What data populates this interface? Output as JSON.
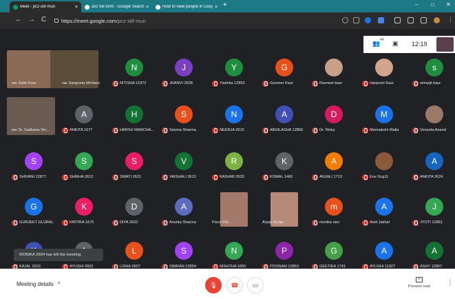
{
  "browser": {
    "tabs": [
      {
        "title": "Meet - pcz-stif-mun",
        "active": true,
        "favicon_color": "#00a85a"
      },
      {
        "title": "avc full form - Google Search",
        "active": false,
        "favicon_color": "#ffffff"
      },
      {
        "title": "How to view people in Google M",
        "active": false,
        "favicon_color": "#ffffff"
      }
    ],
    "new_tab_label": "+",
    "tab_close_label": "×",
    "window_controls": {
      "minimize": "–",
      "maximize": "□",
      "close": "✕"
    },
    "nav": {
      "back": "←",
      "forward": "→",
      "reload": "C"
    },
    "url": {
      "domain": "https://meet.google.com",
      "path": "/pcz-stif-mun"
    }
  },
  "meet_info": {
    "people_icon": "people-icon",
    "people_badge": "44",
    "chat_icon": "chat-icon",
    "time": "12:19"
  },
  "participants": [
    {
      "row": 0,
      "col": 0,
      "name": "Sabir Kaur",
      "video": true,
      "video_color": "#8a6a55",
      "dots": true,
      "mic_off": false
    },
    {
      "row": 0,
      "col": 1,
      "name": "Sangeeta Mehtani",
      "video": true,
      "video_color": "#5a4e3b",
      "dots": true,
      "mic_off": false
    },
    {
      "row": 0,
      "col": 2,
      "name": "NITISHA 11972",
      "initial": "N",
      "color": "#1e8e3e",
      "mic_off": true
    },
    {
      "row": 0,
      "col": 3,
      "name": "JHANVI 2628",
      "initial": "J",
      "color": "#7b3fc4",
      "mic_off": true
    },
    {
      "row": 0,
      "col": 4,
      "name": "Yashika 12852",
      "initial": "Y",
      "color": "#1e8e3e",
      "mic_off": true
    },
    {
      "row": 0,
      "col": 5,
      "name": "Gurnoor Kaur",
      "initial": "G",
      "color": "#e8501c",
      "mic_off": true
    },
    {
      "row": 0,
      "col": 6,
      "name": "Ravneet kaur",
      "photo": true,
      "color": "#c7a08a",
      "mic_off": true
    },
    {
      "row": 0,
      "col": 7,
      "name": "Harpreet Kaur",
      "photo": true,
      "color": "#d1a48b",
      "mic_off": true
    },
    {
      "row": 0,
      "col": 8,
      "name": "simarjit kaur",
      "initial": "s",
      "color": "#1e8e3e",
      "mic_off": true
    },
    {
      "row": 1,
      "col": 0,
      "name": "Dr. Sadhana Ver...",
      "video": true,
      "video_color": "#6a5a50",
      "dots": true,
      "mic_off": false
    },
    {
      "row": 1,
      "col": 1,
      "name": "ANKITA 1677",
      "initial": "A",
      "color": "#5f6368",
      "mic_off": true
    },
    {
      "row": 1,
      "col": 2,
      "name": "HARSH MANCHA...",
      "initial": "H",
      "color": "#137333",
      "mic_off": true
    },
    {
      "row": 1,
      "col": 3,
      "name": "Seema Sharma",
      "initial": "S",
      "color": "#e8501c",
      "mic_off": true
    },
    {
      "row": 1,
      "col": 4,
      "name": "NEERJA 2615",
      "initial": "N",
      "color": "#1a73e8",
      "mic_off": true
    },
    {
      "row": 1,
      "col": 5,
      "name": "ABHILASHA 12856",
      "initial": "A",
      "color": "#3f51b5",
      "mic_off": true
    },
    {
      "row": 1,
      "col": 6,
      "name": "Dr. Rinky",
      "initial": "D",
      "color": "#d81b60",
      "mic_off": true
    },
    {
      "row": 1,
      "col": 7,
      "name": "Meenakshi Walia",
      "initial": "M",
      "color": "#1a73e8",
      "mic_off": true
    },
    {
      "row": 1,
      "col": 8,
      "name": "Veneeta Anand",
      "photo": true,
      "color": "#9a7a66",
      "mic_off": true
    },
    {
      "row": 2,
      "col": 0,
      "name": "SHIVANI 12877",
      "initial": "S",
      "color": "#a142f4",
      "mic_off": true
    },
    {
      "row": 2,
      "col": 1,
      "name": "SHIKHA 2612",
      "initial": "S",
      "color": "#34a853",
      "mic_off": true
    },
    {
      "row": 2,
      "col": 2,
      "name": "SWATI 2621",
      "initial": "S",
      "color": "#e91e63",
      "mic_off": true
    },
    {
      "row": 2,
      "col": 3,
      "name": "VAISHALI 2613",
      "initial": "V",
      "color": "#137333",
      "mic_off": true
    },
    {
      "row": 2,
      "col": 4,
      "name": "RASHMI 2633",
      "initial": "R",
      "color": "#7cb342",
      "mic_off": true
    },
    {
      "row": 2,
      "col": 5,
      "name": "KOMAL 1460",
      "initial": "K",
      "color": "#5f6368",
      "mic_off": true
    },
    {
      "row": 2,
      "col": 6,
      "name": "ANJALI 1713",
      "initial": "A",
      "color": "#f57c00",
      "mic_off": true
    },
    {
      "row": 2,
      "col": 7,
      "name": "Env Gcg11",
      "photo": true,
      "color": "#8a5a3a",
      "mic_off": true
    },
    {
      "row": 2,
      "col": 8,
      "name": "ANKITA 2624",
      "initial": "A",
      "color": "#1565c0",
      "mic_off": true
    },
    {
      "row": 3,
      "col": 0,
      "name": "GURJEET GUJRAL",
      "initial": "G",
      "color": "#1a73e8",
      "mic_off": true
    },
    {
      "row": 3,
      "col": 1,
      "name": "KRITIKA 1675",
      "initial": "K",
      "color": "#e91e63",
      "mic_off": true
    },
    {
      "row": 3,
      "col": 2,
      "name": "DIYA 2632",
      "initial": "D",
      "color": "#5f6368",
      "mic_off": true
    },
    {
      "row": 3,
      "col": 3,
      "name": "Anurita Sharma",
      "initial": "A",
      "color": "#5c6bc0",
      "mic_off": true
    },
    {
      "row": 3,
      "col": 4,
      "name": "Parul Virk ...",
      "video": true,
      "video_color": "#a37a6a",
      "dots": false,
      "mic_off": false
    },
    {
      "row": 3,
      "col": 5,
      "name": "Arpan Kullar",
      "video": true,
      "video_color": "#b58a78",
      "dots": false,
      "mic_off": false
    },
    {
      "row": 3,
      "col": 6,
      "name": "monika rani",
      "initial": "m",
      "color": "#e8501c",
      "mic_off": true
    },
    {
      "row": 3,
      "col": 7,
      "name": "Amit Jakhal",
      "initial": "A",
      "color": "#1a73e8",
      "mic_off": true
    },
    {
      "row": 3,
      "col": 8,
      "name": "JYOTI 12861",
      "initial": "J",
      "color": "#34a853",
      "mic_off": true
    },
    {
      "row": 4,
      "col": 0,
      "name": "KAJAL 2623",
      "initial": "K",
      "color": "#3f51b5",
      "mic_off": true
    },
    {
      "row": 4,
      "col": 1,
      "name": "AYUSHI 2603",
      "initial": "A",
      "color": "#5f6368",
      "mic_off": true
    },
    {
      "row": 4,
      "col": 2,
      "name": "LISHA 2607",
      "initial": "L",
      "color": "#e8501c",
      "mic_off": true
    },
    {
      "row": 4,
      "col": 3,
      "name": "SIMRAN 12854",
      "initial": "S",
      "color": "#a142f4",
      "mic_off": true
    },
    {
      "row": 4,
      "col": 4,
      "name": "NISHTHA 1655",
      "initial": "N",
      "color": "#34a853",
      "mic_off": true
    },
    {
      "row": 4,
      "col": 5,
      "name": "POONAM 12853",
      "initial": "P",
      "color": "#8e24aa",
      "mic_off": true
    },
    {
      "row": 4,
      "col": 6,
      "name": "GEETIKA 1741",
      "initial": "G",
      "color": "#43a047",
      "mic_off": true
    },
    {
      "row": 4,
      "col": 7,
      "name": "AYUSHI 11927",
      "initial": "A",
      "color": "#1a73e8",
      "mic_off": true
    },
    {
      "row": 4,
      "col": 8,
      "name": "ASHY 12867",
      "initial": "A",
      "color": "#137333",
      "mic_off": true
    }
  ],
  "toast": "MONIKA 2604 has left the meeting",
  "bottom": {
    "details_label": "Meeting details",
    "details_chevron": "^",
    "present_label": "Present now",
    "mic_icon": "mic-off-icon",
    "hangup_icon": "hangup-icon",
    "camera_icon": "camera-icon",
    "more_icon": "more-vert-icon"
  }
}
